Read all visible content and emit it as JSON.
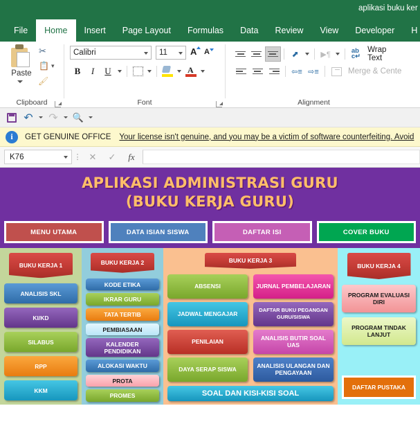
{
  "window": {
    "title": "aplikasi buku ker"
  },
  "ribbon": {
    "tabs": [
      {
        "label": "File",
        "active": false
      },
      {
        "label": "Home",
        "active": true
      },
      {
        "label": "Insert",
        "active": false
      },
      {
        "label": "Page Layout",
        "active": false
      },
      {
        "label": "Formulas",
        "active": false
      },
      {
        "label": "Data",
        "active": false
      },
      {
        "label": "Review",
        "active": false
      },
      {
        "label": "View",
        "active": false
      },
      {
        "label": "Developer",
        "active": false
      },
      {
        "label": "H",
        "active": false
      }
    ],
    "clipboard": {
      "group_label": "Clipboard",
      "paste_label": "Paste",
      "cut_icon": "scissors-icon",
      "copy_icon": "copy-icon",
      "format_painter_icon": "paintbrush-icon"
    },
    "font": {
      "group_label": "Font",
      "font_name": "Calibri",
      "font_size": "11",
      "bold_label": "B",
      "italic_label": "I",
      "underline_label": "U",
      "grow_font_label": "A",
      "shrink_font_label": "A"
    },
    "alignment": {
      "group_label": "Alignment",
      "wrap_text_label": "Wrap Text",
      "merge_center_label": "Merge & Cente"
    }
  },
  "quick_access": {
    "items": [
      "save-icon",
      "undo-icon",
      "redo-icon",
      "print-preview-icon",
      "customize-icon"
    ]
  },
  "license_banner": {
    "title": "GET GENUINE OFFICE",
    "message": "Your license isn't genuine, and you may be a victim of software counterfeiting. Avoid"
  },
  "formula_bar": {
    "name_box": "K76",
    "cancel_icon": "cancel-icon",
    "enter_icon": "check-icon",
    "function_icon": "fx-icon",
    "formula_value": ""
  },
  "sheet": {
    "hero": {
      "line1": "APLIKASI ADMINISTRASI GURU",
      "line2": "(BUKU KERJA GURU)",
      "bg_color": "#7030a0",
      "text_color": "#ffbe69"
    },
    "top_buttons": [
      {
        "label": "MENU UTAMA",
        "color": "#c0504d"
      },
      {
        "label": "DATA ISIAN SISWA",
        "color": "#4f81bd"
      },
      {
        "label": "DAFTAR ISI",
        "color": "#c55fb5"
      },
      {
        "label": "COVER BUKU",
        "color": "#00a651"
      }
    ],
    "panels": [
      {
        "name": "panel-buku-kerja-1",
        "bg_color": "#c3d69b",
        "header": "BUKU  KERJA 1",
        "buttons": [
          {
            "label": "ANALISIS SKL",
            "color": "#3d7ebd",
            "text_color": "#ffffff"
          },
          {
            "label": "KI/KD",
            "color": "#7a4ba0",
            "text_color": "#ffffff"
          },
          {
            "label": "SILABUS",
            "color": "#92c03e",
            "text_color": "#ffffff"
          },
          {
            "label": "RPP",
            "color": "#f79226",
            "text_color": "#ffffff"
          },
          {
            "label": "KKM",
            "color": "#27b0d6",
            "text_color": "#ffffff"
          }
        ]
      },
      {
        "name": "panel-buku-kerja-2",
        "bg_color": "#92cddc",
        "header": "BUKU KERJA 2",
        "buttons": [
          {
            "label": "KODE ETIKA",
            "color": "#3d7ebd",
            "text_color": "#ffffff"
          },
          {
            "label": "IKRAR GURU",
            "color": "#92c03e",
            "text_color": "#ffffff"
          },
          {
            "label": "TATA TERTIB",
            "color": "#f79226",
            "text_color": "#ffffff"
          },
          {
            "label": "PEMBIASAAN",
            "color": "#cfeefb",
            "text_color": "#1c1c1c"
          },
          {
            "label": "KALENDER PENDIDIKAN",
            "color": "#7a4ba0",
            "text_color": "#ffffff",
            "tall": true
          },
          {
            "label": "ALOKASI WAKTU",
            "color": "#3d7ebd",
            "text_color": "#ffffff"
          },
          {
            "label": "PROTA",
            "color": "#fcb3b8",
            "text_color": "#1c1c1c"
          },
          {
            "label": "PROMES",
            "color": "#92c03e",
            "text_color": "#ffffff"
          }
        ]
      },
      {
        "name": "panel-buku-kerja-3",
        "bg_color": "#fac090",
        "header": "BUKU KERJA 3",
        "left_buttons": [
          {
            "label": "ABSENSI",
            "color": "#92c03e",
            "text_color": "#ffffff"
          },
          {
            "label": "JADWAL MENGAJAR",
            "color": "#27b0d6",
            "text_color": "#ffffff"
          },
          {
            "label": "PENILAIAN",
            "color": "#cf4037",
            "text_color": "#ffffff"
          },
          {
            "label": "DAYA SERAP SISWA",
            "color": "#92c03e",
            "text_color": "#ffffff"
          }
        ],
        "right_buttons": [
          {
            "label": "JURNAL PEMBELAJARAN",
            "color": "#e5389b",
            "text_color": "#ffffff"
          },
          {
            "label": "DAFTAR BUKU PEGANGAN GURU/SISWA",
            "color": "#7a4ba0",
            "text_color": "#ffffff"
          },
          {
            "label": "ANALISIS BUTIR SOAL UAS",
            "color": "#d65bb8",
            "text_color": "#ffffff"
          },
          {
            "label": "ANALISIS ULANGAN DAN PENGAYAAN",
            "color": "#3d6fb5",
            "text_color": "#ffffff"
          }
        ],
        "bottom_button": {
          "label": "SOAL DAN KISI-KISI SOAL",
          "color": "#27b0d6",
          "text_color": "#ffffff"
        }
      },
      {
        "name": "panel-buku-kerja-4",
        "bg_color": "#99f0f7",
        "header": "BUKU KERJA 4",
        "buttons": [
          {
            "label": "PROGRAM EVALUASI DIRI",
            "color": "#f6a9ab",
            "text_color": "#1c1c1c"
          },
          {
            "label": "PROGRAM TINDAK LANJUT",
            "color": "#dff0a8",
            "text_color": "#1c1c1c"
          }
        ],
        "footer_button": {
          "label": "DAFTAR PUSTAKA",
          "color": "#e3700b",
          "text_color": "#ffffff"
        }
      }
    ]
  }
}
